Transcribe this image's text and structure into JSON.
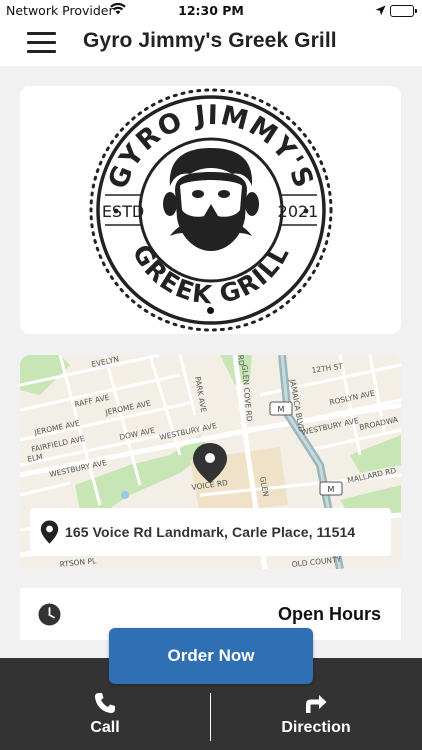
{
  "status_bar": {
    "carrier": "Network Provider",
    "time": "12:30 PM",
    "icons": [
      "wifi-icon",
      "location-arrow-icon",
      "battery-icon"
    ]
  },
  "header": {
    "title": "Gyro Jimmy's Greek Grill",
    "menu_icon": "hamburger-icon"
  },
  "logo": {
    "top_text": "GYRO JIMMY'S",
    "bottom_text": "GREEK GRILL",
    "left_text": "ESTD",
    "right_text": "2021"
  },
  "map": {
    "street_labels": [
      "EVELYN",
      "RAFF AVE",
      "JEROME AVE",
      "JEROME AVE",
      "FAIRFIELD AVE",
      "DOW AVE",
      "ELM",
      "WESTBURY AVE",
      "WESTBURY AVE",
      "PARK AVE",
      "VOICE RD",
      "GLEN COVE RD",
      "RD",
      "GLEN",
      "12TH ST",
      "JAMAICA BLVD",
      "ROSLYN AVE",
      "WESTBURY AVE",
      "BROADWA",
      "MALLARD RD",
      "OLD COUNTY",
      "RTSON PL"
    ],
    "address": "165 Voice Rd Landmark, Carle Place, 11514"
  },
  "hours": {
    "label": "Open Hours"
  },
  "actions": {
    "order_now": "Order Now",
    "call": "Call",
    "direction": "Direction"
  },
  "colors": {
    "order_button": "#2f6fb3",
    "bottom_bar": "#333333",
    "map_road": "#ffffff",
    "map_park": "#c8e6b5",
    "map_highway": "#9ab7bd"
  }
}
